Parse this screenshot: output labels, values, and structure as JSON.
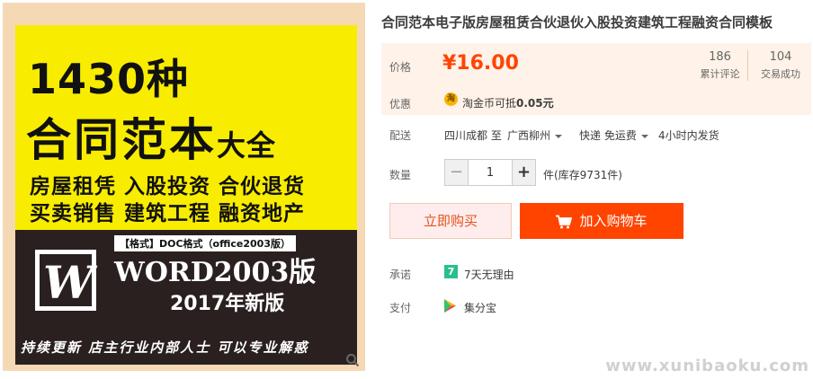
{
  "gallery": {
    "title_line1": "1430种",
    "title_line2_main": "合同范本",
    "title_line2_small": "大全",
    "line1": "房屋租凭 入股投资 合伙退货",
    "line2": "买卖销售 建筑工程 融资地产",
    "format_tag": "【格式】DOC格式（office2003版）",
    "word_logo_letter": "W",
    "word_title": "WORD2003版",
    "edition": "2017年新版",
    "footer": "持续更新 店主行业内部人士 可以专业解惑",
    "zoom_icon": "search-icon"
  },
  "product": {
    "title": "合同范本电子版房屋租赁合伙退伙入股投资建筑工程融资合同模板"
  },
  "price": {
    "label": "价格",
    "value": "¥16.00",
    "reviews_count": "186",
    "reviews_label": "累计评论",
    "sales_count": "104",
    "sales_label": "交易成功"
  },
  "promo": {
    "label": "优惠",
    "coin_glyph": "淘",
    "text_prefix": "淘金币可抵",
    "text_amount": "0.05元"
  },
  "shipping": {
    "label": "配送",
    "from": "四川成都 至",
    "destination": "广西柳州",
    "method": "快递 免运费",
    "time": "4小时内发货"
  },
  "quantity": {
    "label": "数量",
    "minus": "−",
    "value": "1",
    "plus": "+",
    "stock": "件(库存9731件)"
  },
  "actions": {
    "buy_now": "立即购买",
    "add_to_cart": "加入购物车"
  },
  "promise": {
    "label": "承诺",
    "badge": "7",
    "text": "7天无理由"
  },
  "payment": {
    "label": "支付",
    "text": "集分宝"
  },
  "watermark": "www.xunibaoku.com",
  "colors": {
    "accent": "#ff4400",
    "price_bg": "#fff2e8",
    "poster_yellow": "#f8ec00",
    "poster_dark": "#2a2020"
  }
}
